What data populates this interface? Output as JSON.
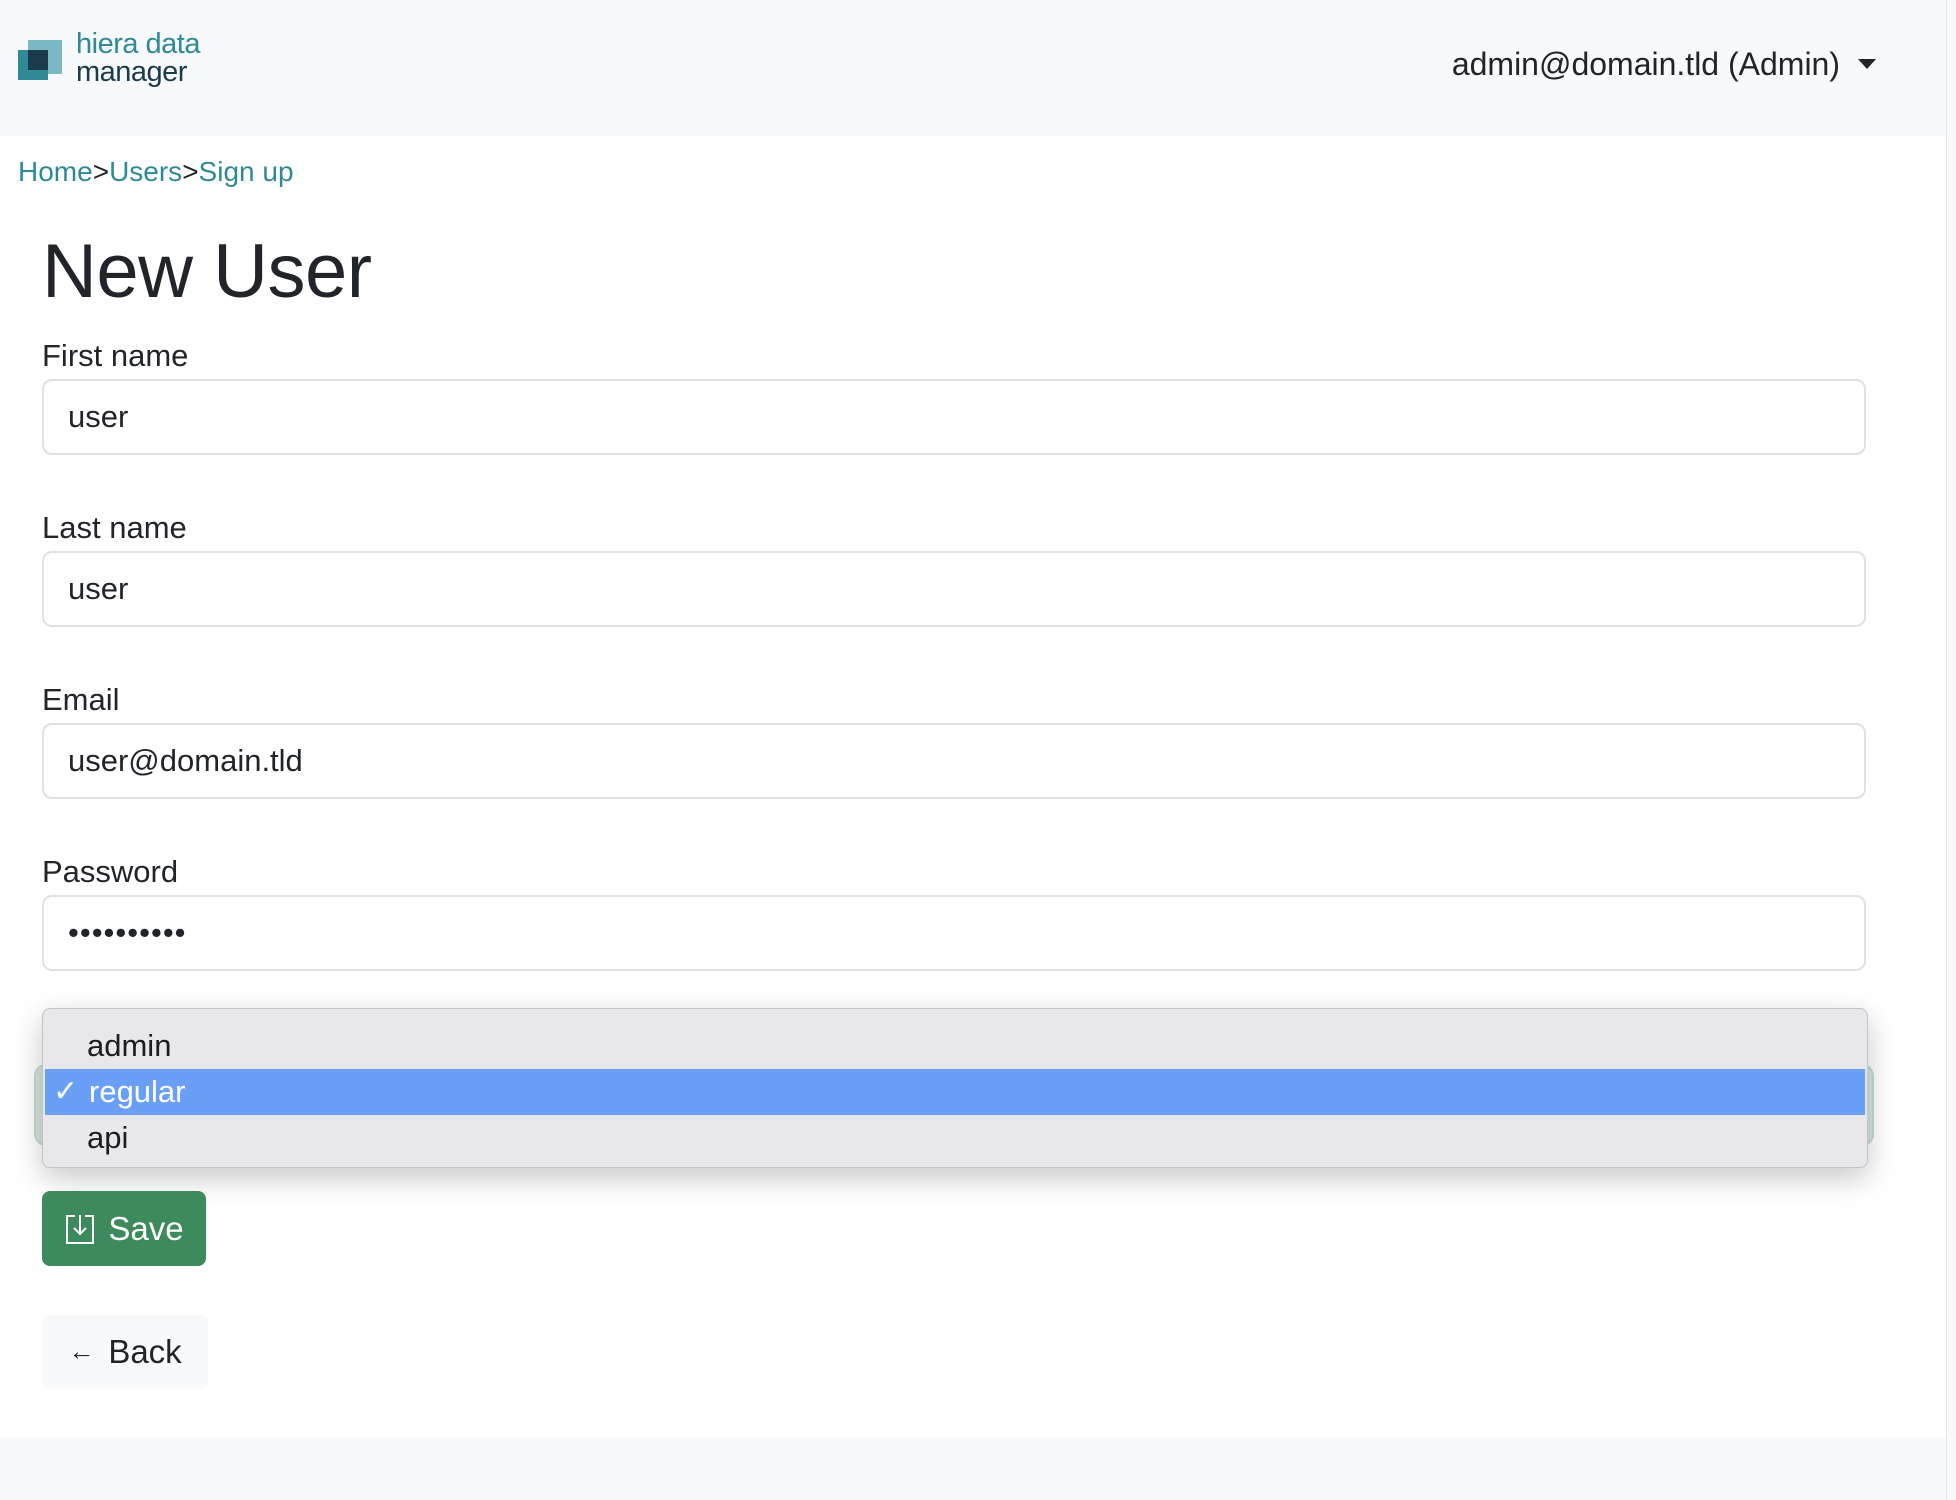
{
  "header": {
    "logo_line1": "hiera data",
    "logo_line2": "manager",
    "user_menu_label": "admin@domain.tld (Admin)"
  },
  "breadcrumb": {
    "items": [
      "Home",
      "Users",
      "Sign up"
    ],
    "separator": ">"
  },
  "page": {
    "title": "New User"
  },
  "form": {
    "first_name": {
      "label": "First name",
      "value": "user"
    },
    "last_name": {
      "label": "Last name",
      "value": "user"
    },
    "email": {
      "label": "Email",
      "value": "user@domain.tld"
    },
    "password": {
      "label": "Password",
      "masked_value": "••••••••••"
    },
    "role_select": {
      "options": [
        "admin",
        "regular",
        "api"
      ],
      "selected": "regular",
      "check_mark": "✓"
    },
    "save_label": "Save",
    "back_label": "Back",
    "back_arrow": "←"
  },
  "colors": {
    "accent": "#2f8a96",
    "save_button": "#3d8a5c",
    "selected_option": "#6a9ff7"
  },
  "icons": {
    "save": "download-box-icon",
    "back": "arrow-left-icon",
    "user_menu": "caret-down-icon"
  }
}
